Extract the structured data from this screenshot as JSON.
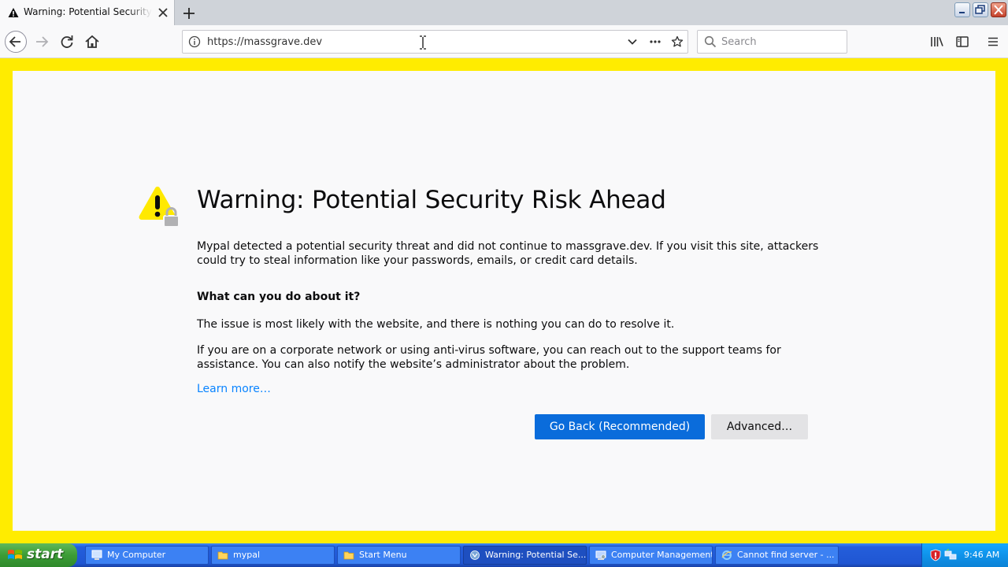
{
  "browser": {
    "tab": {
      "title": "Warning: Potential Security Risk Ahead"
    },
    "url": "https://massgrave.dev",
    "search_placeholder": "Search"
  },
  "page": {
    "heading": "Warning: Potential Security Risk Ahead",
    "intro": "Mypal detected a potential security threat and did not continue to massgrave.dev. If you visit this site, attackers could try to steal information like your passwords, emails, or credit card details.",
    "subheading": "What can you do about it?",
    "para1": "The issue is most likely with the website, and there is nothing you can do to resolve it.",
    "para2": "If you are on a corporate network or using anti-virus software, you can reach out to the support teams for assistance. You can also notify the website’s administrator about the problem.",
    "learn_more": "Learn more…",
    "go_back_label": "Go Back (Recommended)",
    "advanced_label": "Advanced…"
  },
  "taskbar": {
    "start_label": "start",
    "items": [
      {
        "label": "My Computer",
        "icon": "computer-icon"
      },
      {
        "label": "mypal",
        "icon": "folder-icon"
      },
      {
        "label": "Start Menu",
        "icon": "folder-icon"
      },
      {
        "label": "Warning: Potential Se...",
        "icon": "mypal-icon",
        "active": true
      },
      {
        "label": "Computer Management",
        "icon": "management-icon"
      },
      {
        "label": "Cannot find server - ...",
        "icon": "ie-icon"
      }
    ],
    "clock": "9:46 AM"
  },
  "colors": {
    "frame_border": "#ffec00",
    "primary_button": "#0a6cdb",
    "link": "#0a84ff",
    "warning_icon": "#ffe900"
  }
}
